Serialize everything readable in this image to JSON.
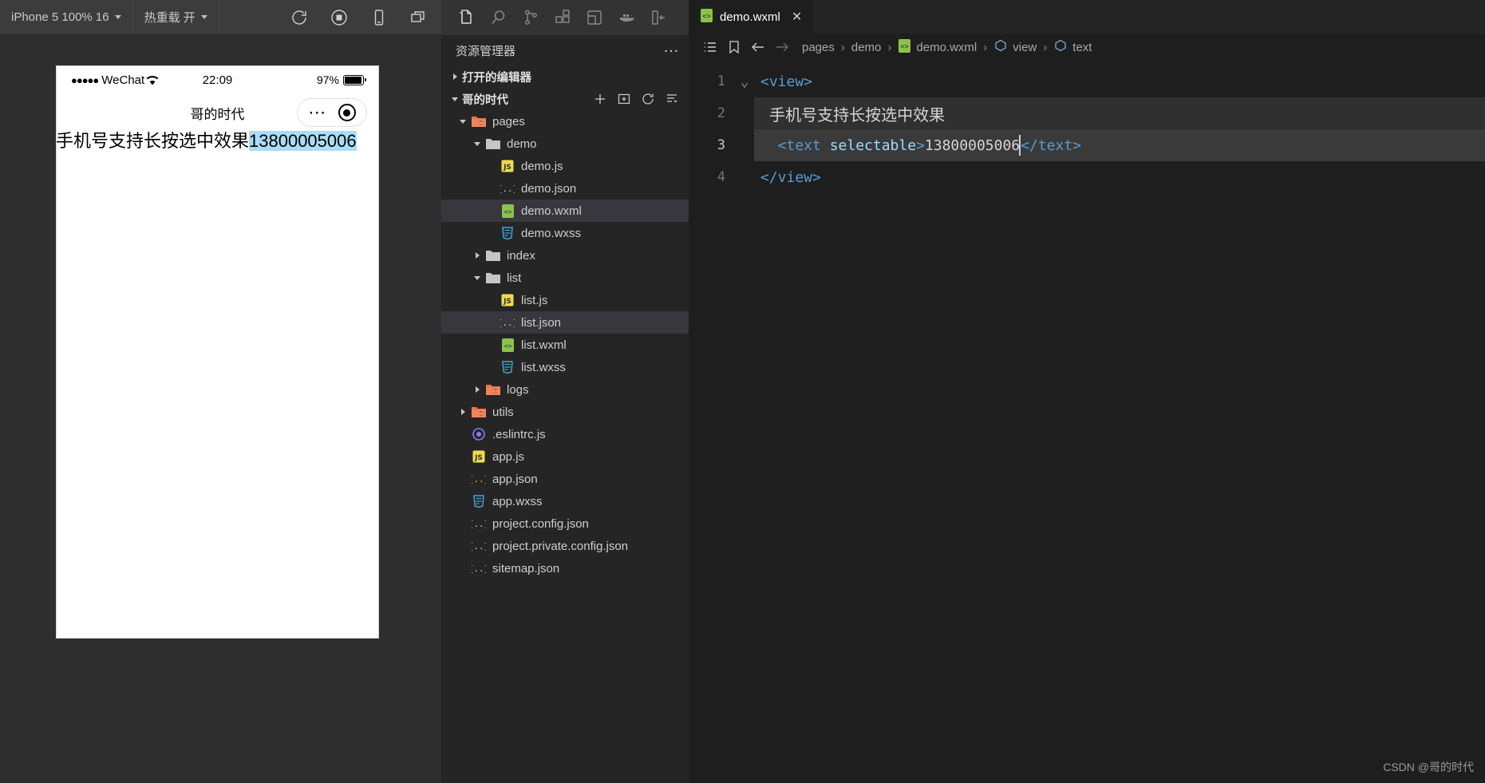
{
  "simulator": {
    "toolbar": {
      "device_label": "iPhone 5 100% 16",
      "hotreload_label": "热重载 开",
      "icons": [
        "refresh-icon",
        "stop-icon",
        "device-icon",
        "windows-icon"
      ]
    },
    "phone": {
      "status": {
        "signal_dots": "●●●●●",
        "carrier": "WeChat",
        "time": "22:09",
        "battery": "97%"
      },
      "nav_title": "哥的时代",
      "content_text": "手机号支持长按选中效果",
      "selected_text": "13800005006"
    }
  },
  "activity_bar": {
    "items": [
      {
        "name": "explorer-icon",
        "active": true
      },
      {
        "name": "search-icon",
        "active": false
      },
      {
        "name": "source-control-icon",
        "active": false
      },
      {
        "name": "extensions-icon",
        "active": false
      },
      {
        "name": "test-icon",
        "active": false
      },
      {
        "name": "docker-icon",
        "active": false
      },
      {
        "name": "toggle-sidebar-icon",
        "active": false
      }
    ]
  },
  "sidebar": {
    "title": "资源管理器",
    "more_label": "…",
    "sections": [
      {
        "label": "打开的编辑器",
        "expanded": false
      },
      {
        "label": "哥的时代",
        "expanded": true
      }
    ],
    "tree": [
      {
        "label": "pages",
        "depth": 1,
        "type": "folder",
        "expanded": true,
        "selected": false
      },
      {
        "label": "demo",
        "depth": 2,
        "type": "folder-plain",
        "expanded": true,
        "selected": false
      },
      {
        "label": "demo.js",
        "depth": 3,
        "type": "js",
        "selected": false
      },
      {
        "label": "demo.json",
        "depth": 3,
        "type": "json",
        "selected": false
      },
      {
        "label": "demo.wxml",
        "depth": 3,
        "type": "wxml",
        "selected": true
      },
      {
        "label": "demo.wxss",
        "depth": 3,
        "type": "wxss",
        "selected": false
      },
      {
        "label": "index",
        "depth": 2,
        "type": "folder-plain",
        "expanded": false,
        "selected": false
      },
      {
        "label": "list",
        "depth": 2,
        "type": "folder-plain",
        "expanded": true,
        "selected": false
      },
      {
        "label": "list.js",
        "depth": 3,
        "type": "js",
        "selected": false
      },
      {
        "label": "list.json",
        "depth": 3,
        "type": "json",
        "selected": true
      },
      {
        "label": "list.wxml",
        "depth": 3,
        "type": "wxml",
        "selected": false
      },
      {
        "label": "list.wxss",
        "depth": 3,
        "type": "wxss",
        "selected": false
      },
      {
        "label": "logs",
        "depth": 2,
        "type": "folder",
        "expanded": false,
        "selected": false
      },
      {
        "label": "utils",
        "depth": 1,
        "type": "folder",
        "expanded": false,
        "selected": false
      },
      {
        "label": ".eslintrc.js",
        "depth": 1,
        "type": "eslint",
        "selected": false
      },
      {
        "label": "app.js",
        "depth": 1,
        "type": "js",
        "selected": false
      },
      {
        "label": "app.json",
        "depth": 1,
        "type": "json",
        "selected": false
      },
      {
        "label": "app.wxss",
        "depth": 1,
        "type": "wxss",
        "selected": false
      },
      {
        "label": "project.config.json",
        "depth": 1,
        "type": "json",
        "selected": false
      },
      {
        "label": "project.private.config.json",
        "depth": 1,
        "type": "json",
        "selected": false
      },
      {
        "label": "sitemap.json",
        "depth": 1,
        "type": "json",
        "selected": false
      }
    ],
    "section_actions": [
      "new-file-icon",
      "new-folder-icon",
      "refresh-icon",
      "collapse-all-icon"
    ]
  },
  "editor": {
    "tab": {
      "label": "demo.wxml",
      "close": "✕"
    },
    "breadcrumb": {
      "icons": [
        "outline-icon",
        "bookmark-icon",
        "back-arrow-icon",
        "forward-arrow-icon"
      ],
      "items": [
        "pages",
        "demo",
        "demo.wxml",
        "view",
        "text"
      ],
      "separator": "›"
    },
    "lines": [
      {
        "num": "1",
        "fold": "⌄",
        "highlight": false,
        "tokens": [
          {
            "t": "tag",
            "v": "<view>"
          }
        ]
      },
      {
        "num": "2",
        "fold": "",
        "highlight": "soft",
        "tokens": [
          {
            "t": "cn",
            "v": "  手机号支持长按选中效果"
          }
        ]
      },
      {
        "num": "3",
        "fold": "",
        "highlight": "strong",
        "tokens": [
          {
            "t": "tag",
            "v": "  <text "
          },
          {
            "t": "attr",
            "v": "selectable"
          },
          {
            "t": "tag",
            "v": ">"
          },
          {
            "t": "txt",
            "v": "13800005006"
          },
          {
            "t": "tag",
            "v": "</text>"
          }
        ]
      },
      {
        "num": "4",
        "fold": "",
        "highlight": false,
        "tokens": [
          {
            "t": "tag",
            "v": "</view>"
          }
        ]
      }
    ]
  },
  "watermark": "CSDN @哥的时代",
  "colors": {
    "devtools_bg": "#2e2e2e",
    "toolbar_bg": "#3c3c3c",
    "sidebar_bg": "#252526",
    "editor_bg": "#1e1e1e",
    "activity_bg": "#333333",
    "selection_highlight": "#aadcf5",
    "tag_blue": "#569cd6",
    "attr_blue": "#9cdcfe",
    "text_gray": "#d4d4d4"
  }
}
